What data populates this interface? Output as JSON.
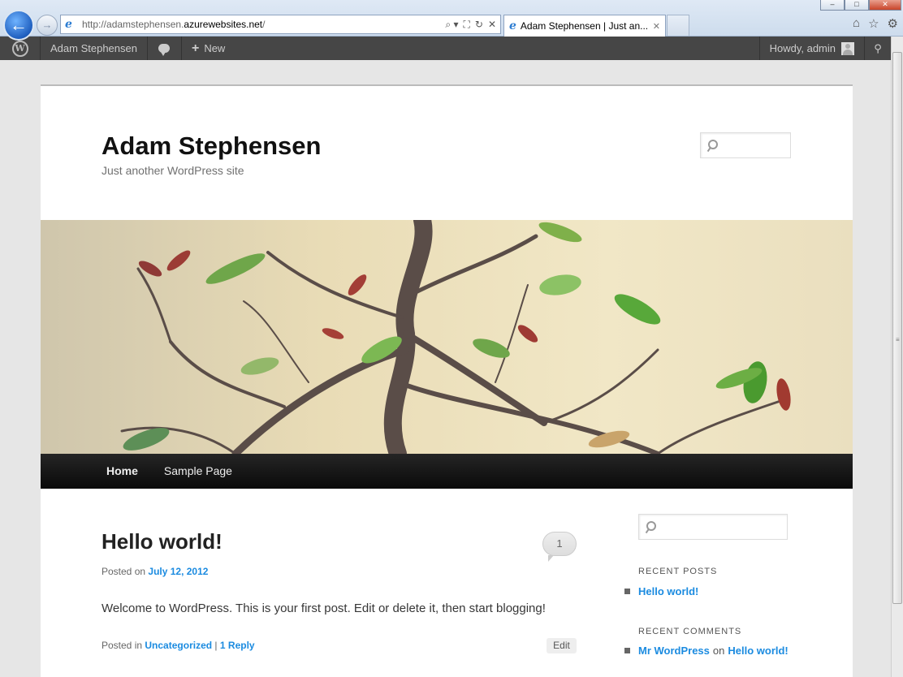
{
  "browser": {
    "address_url_prefix": "http://adamstephensen.",
    "address_url_domain": "azurewebsites.net",
    "address_url_suffix": "/",
    "tab_title": "Adam Stephensen | Just an...",
    "tab_close": "✕",
    "back_arrow": "←",
    "forward_arrow": "→",
    "ie_icon": "e",
    "win_minimize": "–",
    "win_maximize": "□",
    "win_close": "✕",
    "address_tools": [
      "⌕ ▾",
      "⛶",
      "↻",
      "✕"
    ],
    "right_icons": [
      "⌂",
      "☆",
      "⚙"
    ]
  },
  "admin_bar": {
    "logo_letter": "W",
    "site_name": "Adam Stephensen",
    "new_plus": "+",
    "new_label": "New",
    "howdy": "Howdy, admin",
    "search_icon": "⚲"
  },
  "site": {
    "title": "Adam Stephensen",
    "description": "Just another WordPress site"
  },
  "nav": {
    "items": [
      {
        "label": "Home"
      },
      {
        "label": "Sample Page"
      }
    ]
  },
  "post": {
    "title": "Hello world!",
    "comment_count": "1",
    "posted_on": "Posted on",
    "date": "July 12, 2012",
    "content": "Welcome to WordPress. This is your first post. Edit or delete it, then start blogging!",
    "posted_in": "Posted in",
    "category": "Uncategorized",
    "separator": "|",
    "reply_link": "1 Reply",
    "edit": "Edit"
  },
  "sidebar": {
    "recent_posts_title": "Recent Posts",
    "recent_posts": [
      "Hello world!"
    ],
    "recent_comments_title": "Recent Comments",
    "recent_comment_author": "Mr WordPress",
    "recent_comment_on": "on",
    "recent_comment_post": "Hello world!"
  },
  "colors": {
    "link": "#1b8be0",
    "admin_bar": "#464646",
    "nav_bar": "#111111"
  },
  "icons": [
    "back-arrow-icon",
    "forward-arrow-icon",
    "ie-logo-icon",
    "search-icon",
    "refresh-icon",
    "stop-icon",
    "home-icon",
    "favorites-star-icon",
    "gear-icon",
    "wordpress-logo-icon",
    "comment-bubble-icon",
    "plus-icon",
    "avatar-icon"
  ]
}
